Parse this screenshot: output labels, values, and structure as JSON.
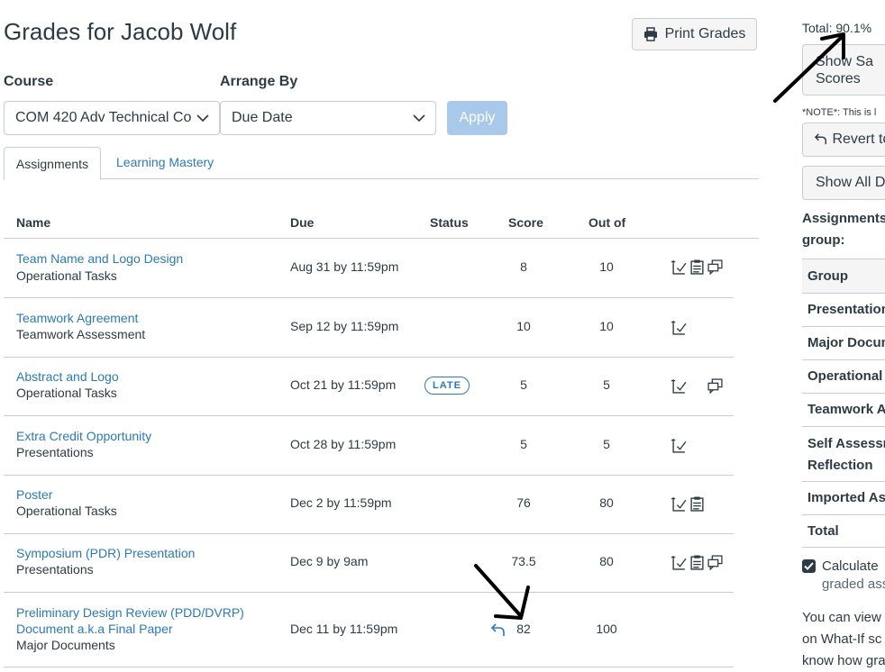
{
  "page": {
    "title": "Grades for Jacob Wolf",
    "print_label": "Print Grades"
  },
  "filters": {
    "course_label": "Course",
    "course_value": "COM 420 Adv Technical Co",
    "arrange_label": "Arrange By",
    "arrange_value": "Due Date",
    "apply_label": "Apply"
  },
  "tabs": [
    {
      "label": "Assignments",
      "active": true
    },
    {
      "label": "Learning Mastery",
      "active": false
    }
  ],
  "table": {
    "headers": {
      "name": "Name",
      "due": "Due",
      "status": "Status",
      "score": "Score",
      "out_of": "Out of"
    },
    "rows": [
      {
        "name": "Team Name and Logo Design",
        "group": "Operational Tasks",
        "due": "Aug 31 by 11:59pm",
        "status": "",
        "score": "8",
        "out_of": "10",
        "icons": [
          "rubric-icon",
          "details-icon",
          "comments-icon"
        ]
      },
      {
        "name": "Teamwork Agreement",
        "group": "Teamwork Assessment",
        "due": "Sep 12 by 11:59pm",
        "status": "",
        "score": "10",
        "out_of": "10",
        "icons": [
          "rubric-icon"
        ]
      },
      {
        "name": "Abstract and Logo",
        "group": "Operational Tasks",
        "due": "Oct 21 by 11:59pm",
        "status": "LATE",
        "score": "5",
        "out_of": "5",
        "icons": [
          "rubric-icon",
          "comments-icon"
        ]
      },
      {
        "name": "Extra Credit Opportunity",
        "group": "Presentations",
        "due": "Oct 28 by 11:59pm",
        "status": "",
        "score": "5",
        "out_of": "5",
        "icons": [
          "rubric-icon"
        ]
      },
      {
        "name": "Poster",
        "group": "Operational Tasks",
        "due": "Dec 2 by 11:59pm",
        "status": "",
        "score": "76",
        "out_of": "80",
        "icons": [
          "rubric-icon",
          "details-icon"
        ]
      },
      {
        "name": "Symposium (PDR) Presentation",
        "group": "Presentations",
        "due": "Dec 9 by 9am",
        "status": "",
        "score": "73.5",
        "out_of": "80",
        "icons": [
          "rubric-icon",
          "details-icon",
          "comments-icon"
        ]
      },
      {
        "name_line1": "Preliminary Design Review (PDD/DVRP)",
        "name_line2": "Document a.k.a Final Paper",
        "group": "Major Documents",
        "due": "Dec 11 by 11:59pm",
        "status": "",
        "score": "82",
        "out_of": "100",
        "icons": []
      }
    ]
  },
  "sidebar": {
    "total": "Total: 90.1%",
    "show_saved_line1": "Show Sa",
    "show_saved_line2": "Scores",
    "note": "*NOTE*: This is l",
    "revert_label": "Revert to",
    "show_all_label": "Show All D",
    "heading_line1": "Assignments",
    "heading_line2": "group:",
    "groups": [
      "Group",
      "Presentation",
      "Major Docum",
      "Operational",
      "Teamwork A",
      "Self Assessm",
      "Reflection",
      "Imported As",
      "Total"
    ],
    "calc_line1": "Calculate",
    "calc_line2": "graded ass",
    "footer_line1": "You can view",
    "footer_line2": "on What-If sc",
    "footer_line3": "know how gra"
  },
  "colors": {
    "link": "#2b7abc",
    "text": "#2d3b45",
    "border": "#c7cdd1",
    "apply_bg": "#a8c9e9"
  }
}
